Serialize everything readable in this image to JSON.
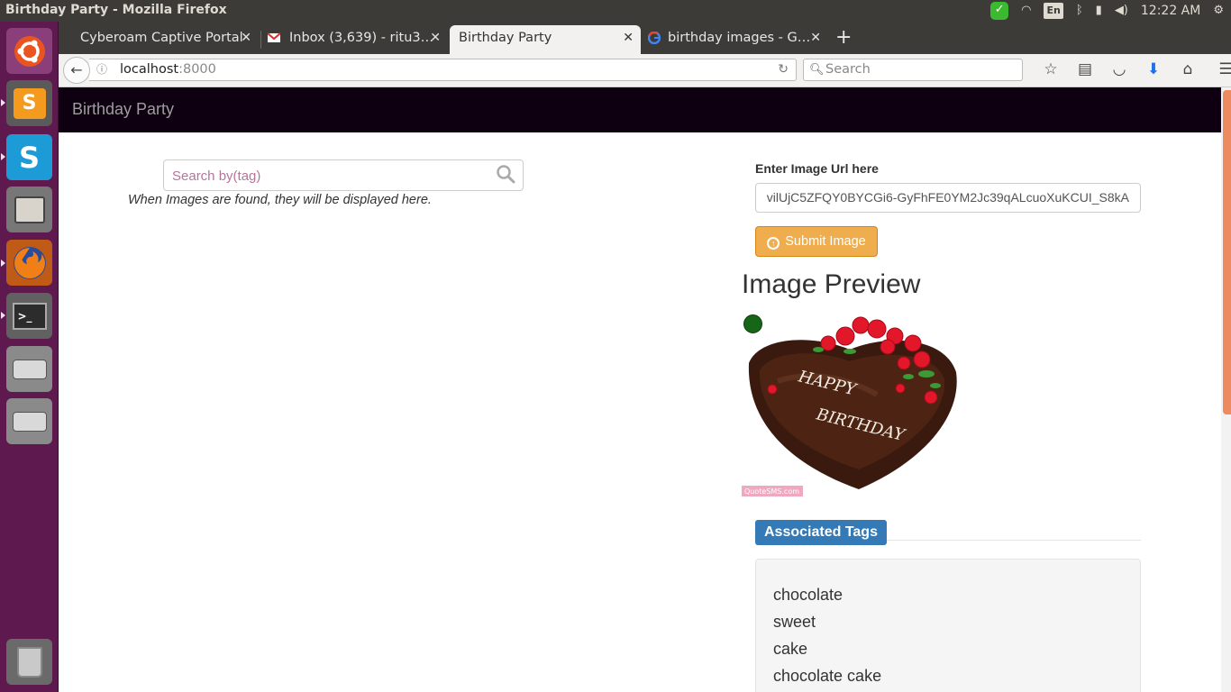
{
  "window": {
    "title": "Birthday Party - Mozilla Firefox"
  },
  "system_tray": {
    "keyboard": "En",
    "time": "12:22 AM"
  },
  "launcher": {
    "items": [
      "ubuntu-dash",
      "sublime-text",
      "skype",
      "files-archive",
      "firefox",
      "terminal",
      "drive-1",
      "drive-2",
      "trash"
    ]
  },
  "tabs": [
    {
      "label": "Cyberoam Captive Portal"
    },
    {
      "label": "Inbox (3,639) - ritu3…"
    },
    {
      "label": "Birthday Party"
    },
    {
      "label": "birthday images - G…"
    }
  ],
  "address": {
    "host": "localhost",
    "port": ":8000"
  },
  "browser_search": {
    "placeholder": "Search"
  },
  "app": {
    "brand": "Birthday Party",
    "search_placeholder": "Search by(tag)",
    "hint": "When Images are found, they will be displayed here.",
    "url_label": "Enter Image Url here",
    "url_value": "vilUjC5ZFQY0BYCGi6-GyFhFE0YM2Jc39qALcuoXuKCUI_S8kA",
    "submit_label": "Submit Image",
    "preview_title": "Image Preview",
    "cake_text_1": "HAPPY",
    "cake_text_2": "BIRTHDAY",
    "watermark": "QuoteSMS.com",
    "tags_title": "Associated Tags",
    "tags": [
      "chocolate",
      "sweet",
      "cake",
      "chocolate cake"
    ]
  },
  "colors": {
    "navbar_bg": "#0e0011",
    "submit_bg": "#f0ad4e",
    "badge_bg": "#337ab7",
    "launcher_bg": "#5e1a4e",
    "scroll_thumb": "#ee8a5f"
  }
}
